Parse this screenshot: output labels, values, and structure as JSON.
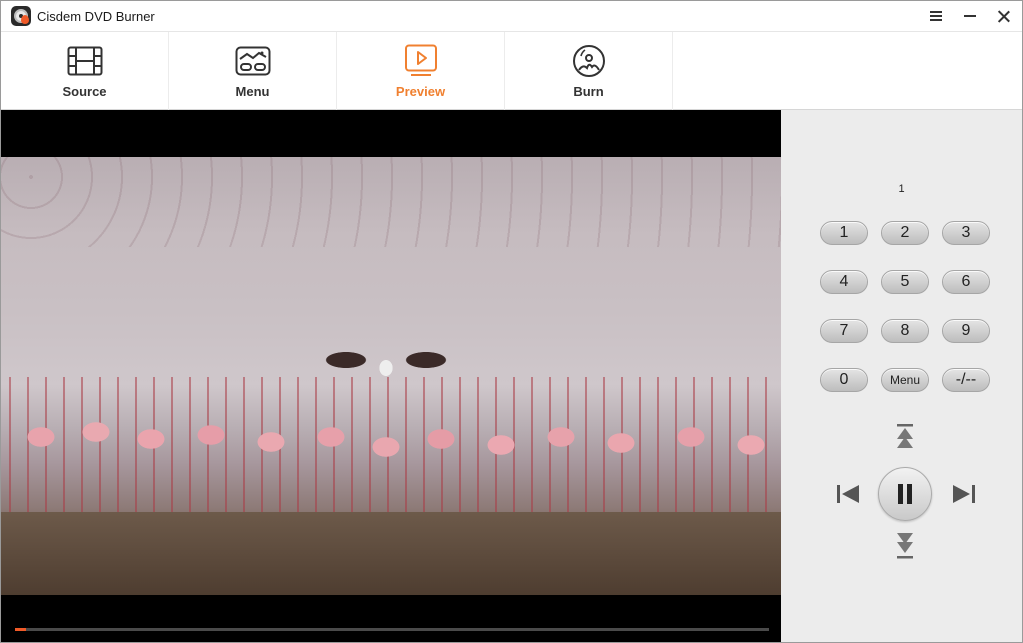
{
  "window": {
    "title": "Cisdem DVD Burner"
  },
  "toolbar": {
    "items": [
      {
        "label": "Source",
        "icon": "film-strip-icon"
      },
      {
        "label": "Menu",
        "icon": "menu-layout-icon"
      },
      {
        "label": "Preview",
        "icon": "play-screen-icon",
        "active": true
      },
      {
        "label": "Burn",
        "icon": "disc-burn-icon"
      }
    ],
    "active_color": "#f08030"
  },
  "player": {
    "progress_fraction": 0.015,
    "progress_color": "#f05a28"
  },
  "remote": {
    "chapter_display": "1",
    "keys": [
      "1",
      "2",
      "3",
      "4",
      "5",
      "6",
      "7",
      "8",
      "9",
      "0",
      "Menu",
      "-/--"
    ],
    "controls": [
      "up-arrow-icon",
      "previous-icon",
      "pause-icon",
      "next-icon",
      "down-arrow-icon"
    ]
  }
}
